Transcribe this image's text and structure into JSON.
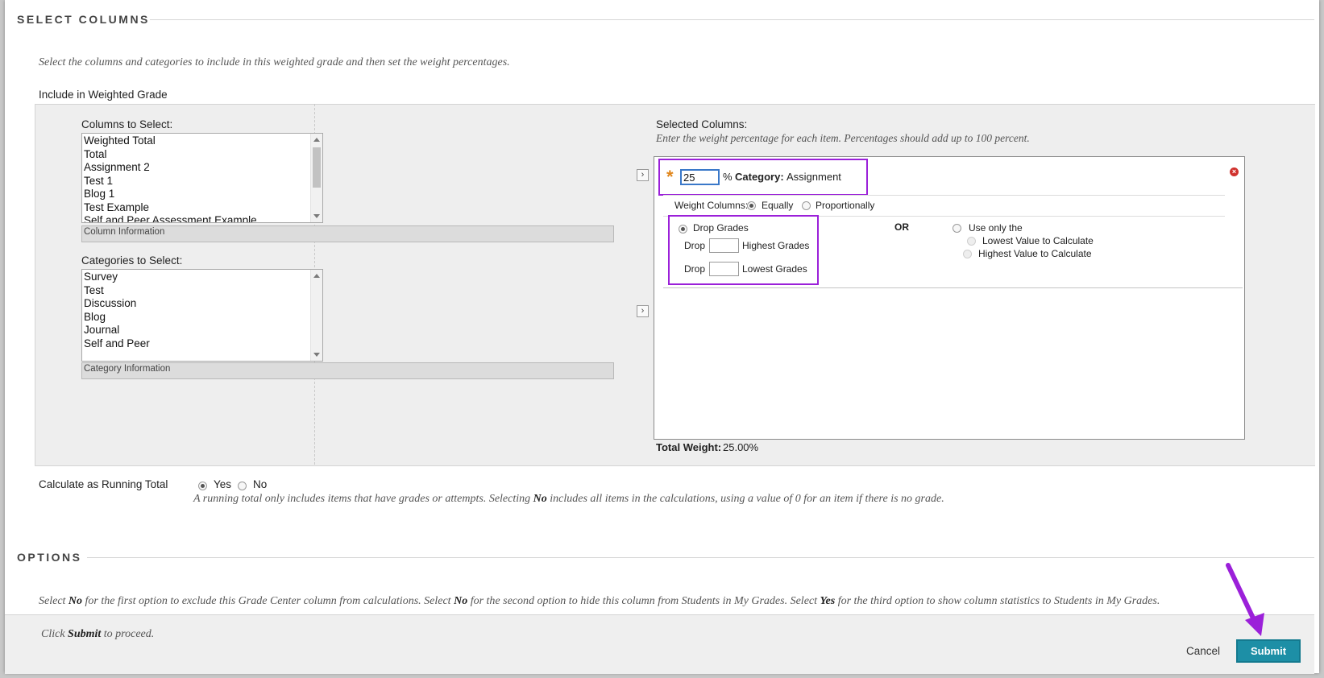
{
  "select_columns": {
    "heading": "SELECT COLUMNS",
    "instructions": "Select the columns and categories to include in this weighted grade and then set the weight percentages.",
    "include_label": "Include in Weighted Grade",
    "columns_label": "Columns to Select:",
    "columns": [
      "Weighted Total",
      "Total",
      "Assignment 2",
      "Test 1",
      "Blog 1",
      "Test Example",
      "Self and Peer Assessment Example"
    ],
    "column_info": "Column Information",
    "categories_label": "Categories to Select:",
    "categories": [
      "Survey",
      "Test",
      "Discussion",
      "Blog",
      "Journal",
      "Self and Peer"
    ],
    "category_info": "Category Information",
    "selected_label": "Selected Columns:",
    "selected_instructions": "Enter the weight percentage for each item. Percentages should add up to 100 percent.",
    "item": {
      "required_star": "*",
      "weight_value": "25",
      "percent_sign": "%",
      "category_prefix": "Category:",
      "category_name": "Assignment",
      "weight_columns_label": "Weight Columns:",
      "equally": "Equally",
      "proportionally": "Proportionally",
      "drop_grades": "Drop Grades",
      "drop1": "Drop",
      "highest_grades": "Highest Grades",
      "drop2": "Drop",
      "lowest_grades": "Lowest Grades",
      "or": "OR",
      "use_only": "Use only the",
      "lowest_value": "Lowest Value to Calculate",
      "highest_value": "Highest Value to Calculate",
      "remove_icon": "remove-icon"
    },
    "total_weight_label": "Total Weight:",
    "total_weight_value": "25.00%"
  },
  "running_total": {
    "label": "Calculate as Running Total",
    "yes": "Yes",
    "no": "No",
    "note_a": "A running total only includes items that have grades or attempts. Selecting ",
    "note_b": "No",
    "note_c": " includes all items in the calculations, using a value of 0 for an item if there is no grade."
  },
  "options": {
    "heading": "OPTIONS",
    "p1": "Select ",
    "b1": "No",
    "p2": " for the first option to exclude this Grade Center column from calculations. Select ",
    "b2": "No",
    "p3": " for the second option to hide this column from Students in My Grades. Select ",
    "b3": "Yes",
    "p4": " for the third option to show column statistics to Students in My Grades."
  },
  "footer": {
    "click": "Click ",
    "submit_word": "Submit",
    "proceed": " to proceed.",
    "cancel": "Cancel",
    "submit": "Submit"
  },
  "colors": {
    "highlight": "#9b20d9",
    "submit": "#1d8fa6",
    "required": "#e0851a",
    "remove": "#d0312d"
  }
}
